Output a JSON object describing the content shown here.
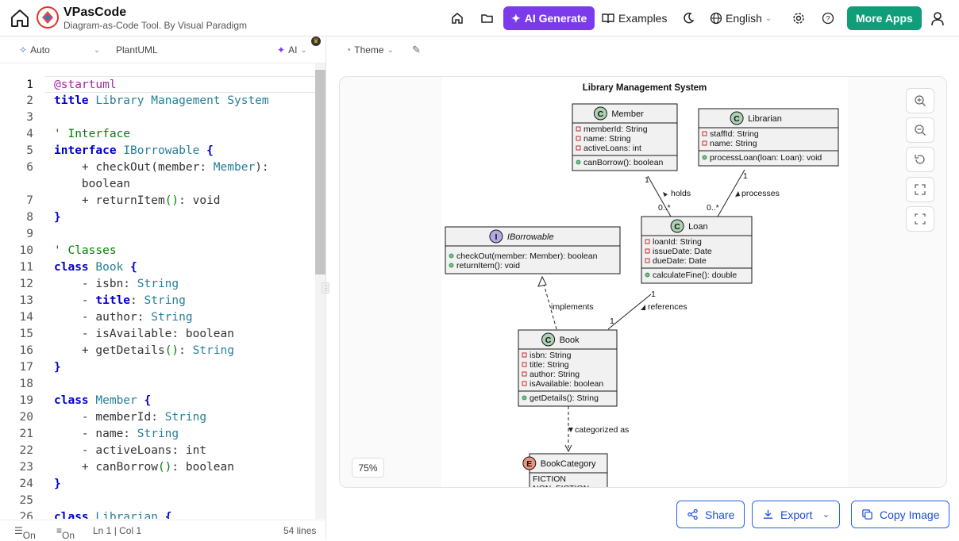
{
  "header": {
    "app_name": "VPasCode",
    "app_subtitle": "Diagram-as-Code Tool. By Visual Paradigm",
    "ai_generate": "AI Generate",
    "examples": "Examples",
    "language": "English",
    "more_apps": "More Apps"
  },
  "editor_toolbar": {
    "mode": "Auto",
    "language": "PlantUML",
    "ai": "AI"
  },
  "preview_toolbar": {
    "theme": "Theme"
  },
  "editor": {
    "lines": [
      {
        "n": "1",
        "t": [
          [
            "@startuml",
            "pu"
          ]
        ]
      },
      {
        "n": "2",
        "t": [
          [
            "title ",
            "kw"
          ],
          [
            "Library Management System",
            "tt"
          ]
        ]
      },
      {
        "n": "3",
        "t": []
      },
      {
        "n": "4",
        "t": [
          [
            "' Interface",
            "cm"
          ]
        ]
      },
      {
        "n": "5",
        "t": [
          [
            "interface ",
            "kw"
          ],
          [
            "IBorrowable ",
            "ty"
          ],
          [
            "{",
            "kw"
          ]
        ]
      },
      {
        "n": "6",
        "t": [
          [
            "    + checkOut(member: ",
            "pl"
          ],
          [
            "Member",
            "ty"
          ],
          [
            "):",
            "pl"
          ]
        ]
      },
      {
        "n": "",
        "t": [
          [
            "    boolean",
            "pl"
          ]
        ]
      },
      {
        "n": "7",
        "t": [
          [
            "    + returnItem",
            "pl"
          ],
          [
            "()",
            "cm"
          ],
          [
            ": void",
            "pl"
          ]
        ]
      },
      {
        "n": "8",
        "t": [
          [
            "}",
            "kw"
          ]
        ]
      },
      {
        "n": "9",
        "t": []
      },
      {
        "n": "10",
        "t": [
          [
            "' Classes",
            "cm"
          ]
        ]
      },
      {
        "n": "11",
        "t": [
          [
            "class ",
            "kw"
          ],
          [
            "Book ",
            "ty"
          ],
          [
            "{",
            "kw"
          ]
        ]
      },
      {
        "n": "12",
        "t": [
          [
            "    - isbn: ",
            "pl"
          ],
          [
            "String",
            "ty"
          ]
        ]
      },
      {
        "n": "13",
        "t": [
          [
            "    - ",
            "pl"
          ],
          [
            "title",
            "kw"
          ],
          [
            ": ",
            "pl"
          ],
          [
            "String",
            "ty"
          ]
        ]
      },
      {
        "n": "14",
        "t": [
          [
            "    - author: ",
            "pl"
          ],
          [
            "String",
            "ty"
          ]
        ]
      },
      {
        "n": "15",
        "t": [
          [
            "    - isAvailable: boolean",
            "pl"
          ]
        ]
      },
      {
        "n": "16",
        "t": [
          [
            "    + getDetails",
            "pl"
          ],
          [
            "()",
            "cm"
          ],
          [
            ": ",
            "pl"
          ],
          [
            "String",
            "ty"
          ]
        ]
      },
      {
        "n": "17",
        "t": [
          [
            "}",
            "kw"
          ]
        ]
      },
      {
        "n": "18",
        "t": []
      },
      {
        "n": "19",
        "t": [
          [
            "class ",
            "kw"
          ],
          [
            "Member ",
            "ty"
          ],
          [
            "{",
            "kw"
          ]
        ]
      },
      {
        "n": "20",
        "t": [
          [
            "    - memberId: ",
            "pl"
          ],
          [
            "String",
            "ty"
          ]
        ]
      },
      {
        "n": "21",
        "t": [
          [
            "    - name: ",
            "pl"
          ],
          [
            "String",
            "ty"
          ]
        ]
      },
      {
        "n": "22",
        "t": [
          [
            "    - activeLoans: int",
            "pl"
          ]
        ]
      },
      {
        "n": "23",
        "t": [
          [
            "    + canBorrow",
            "pl"
          ],
          [
            "()",
            "cm"
          ],
          [
            ": boolean",
            "pl"
          ]
        ]
      },
      {
        "n": "24",
        "t": [
          [
            "}",
            "kw"
          ]
        ]
      },
      {
        "n": "25",
        "t": []
      },
      {
        "n": "26",
        "t": [
          [
            "class ",
            "kw"
          ],
          [
            "Librarian ",
            "ty"
          ],
          [
            "{",
            "kw"
          ]
        ]
      }
    ]
  },
  "status_bar": {
    "wrap": "On",
    "minimap": "On",
    "cursor": "Ln 1 | Col 1",
    "lines": "54 lines"
  },
  "diagram": {
    "title": "Library Management System",
    "classes": {
      "member": {
        "stereo": "C",
        "name": "Member",
        "attrs": [
          "memberId: String",
          "name: String",
          "activeLoans: int"
        ],
        "ops": [
          "canBorrow(): boolean"
        ]
      },
      "librarian": {
        "stereo": "C",
        "name": "Librarian",
        "attrs": [
          "staffId: String",
          "name: String"
        ],
        "ops": [
          "processLoan(loan: Loan): void"
        ]
      },
      "iborrowable": {
        "stereo": "I",
        "name": "IBorrowable",
        "attrs": [],
        "ops": [
          "checkOut(member: Member): boolean",
          "returnItem(): void"
        ]
      },
      "loan": {
        "stereo": "C",
        "name": "Loan",
        "attrs": [
          "loanId: String",
          "issueDate: Date",
          "dueDate: Date"
        ],
        "ops": [
          "calculateFine(): double"
        ]
      },
      "book": {
        "stereo": "C",
        "name": "Book",
        "attrs": [
          "isbn: String",
          "title: String",
          "author: String",
          "isAvailable: boolean"
        ],
        "ops": [
          "getDetails(): String"
        ]
      },
      "category": {
        "stereo": "E",
        "name": "BookCategory",
        "attrs": [
          "FICTION",
          "NON_FICTION"
        ],
        "ops": []
      }
    },
    "links": {
      "holds": "holds",
      "holds_m1": "1",
      "holds_m2": "0..*",
      "processes": "processes",
      "proc_m1": "1",
      "proc_m2": "0..*",
      "implements": "implements",
      "references": "references",
      "ref_m1": "1",
      "ref_m2": "1",
      "categorized": "categorized as"
    }
  },
  "zoom_level": "75%",
  "actions": {
    "share": "Share",
    "export": "Export",
    "copy_image": "Copy Image"
  },
  "colors": {
    "ai_generate": "#7c3aed",
    "more_apps": "#0f9d7a",
    "action_border": "#2563eb"
  }
}
